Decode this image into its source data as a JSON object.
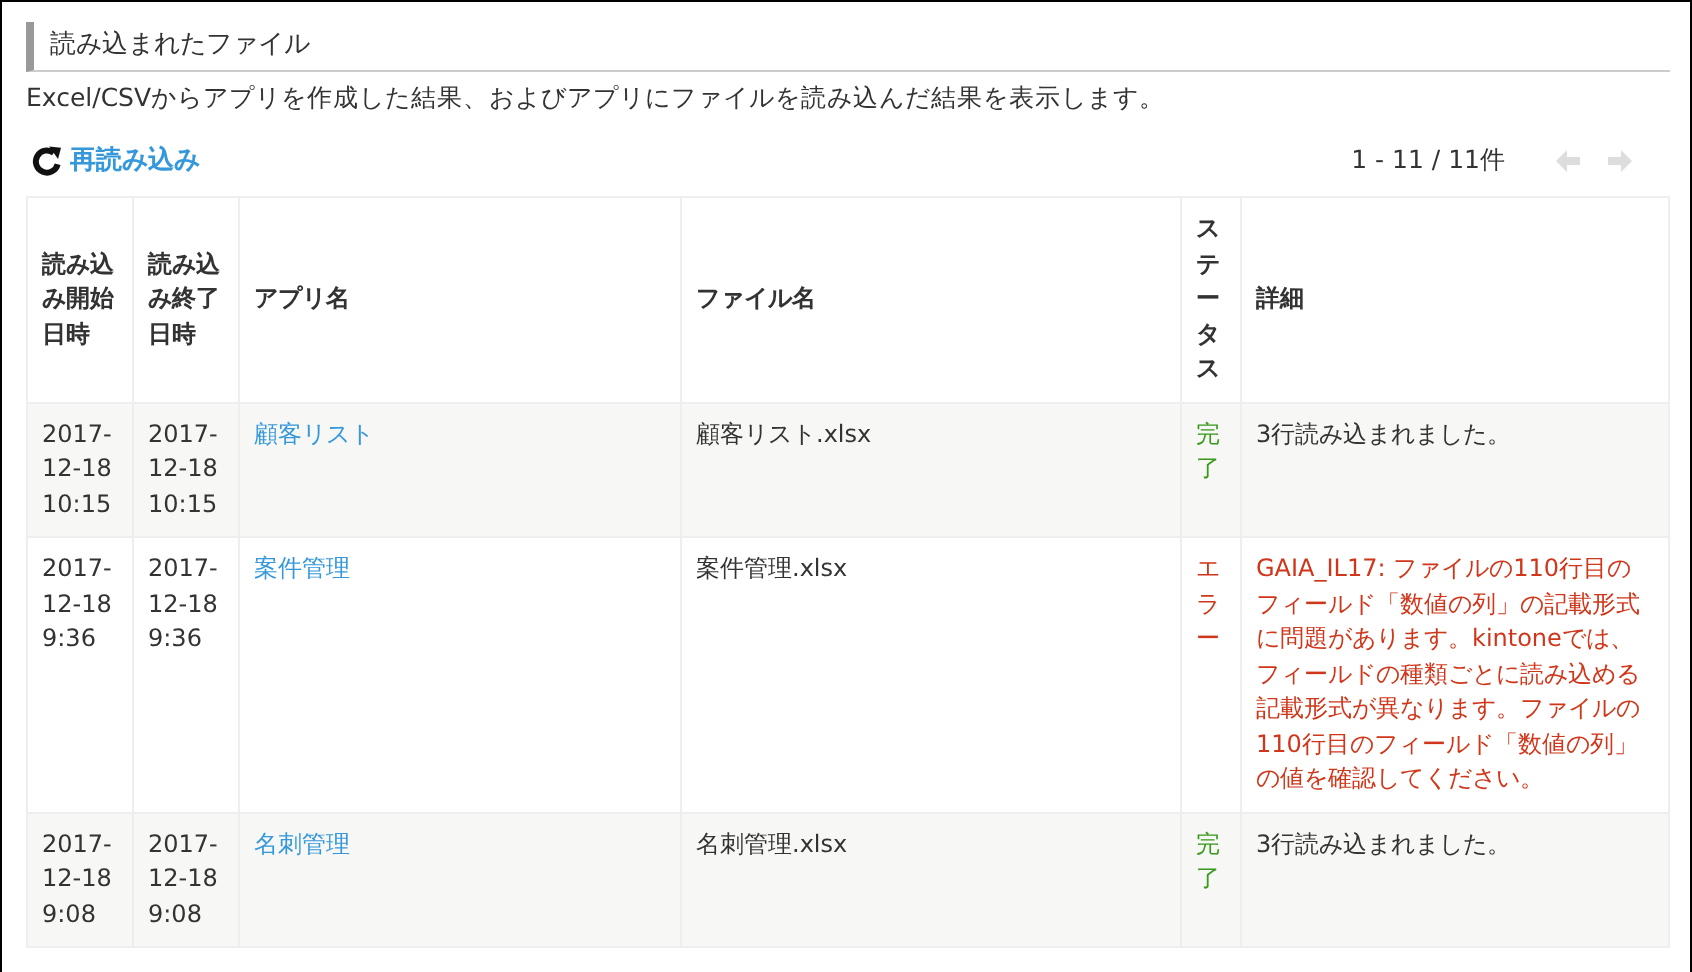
{
  "section_title": "読み込まれたファイル",
  "description": "Excel/CSVからアプリを作成した結果、およびアプリにファイルを読み込んだ結果を表示します。",
  "reload_link": "再読み込み",
  "pager": {
    "range": "1 - 11 / 11件",
    "prev_disabled": true,
    "next_disabled": true
  },
  "table": {
    "columns": [
      "読み込み開始日時",
      "読み込み終了日時",
      "アプリ名",
      "ファイル名",
      "ステータス",
      "詳細"
    ],
    "rows": [
      {
        "start": "2017-12-18 10:15",
        "end": "2017-12-18 10:15",
        "app": "顧客リスト",
        "file": "顧客リスト.xlsx",
        "status": "完了",
        "kind": "done",
        "detail": "3行読み込まれました。"
      },
      {
        "start": "2017-12-18 9:36",
        "end": "2017-12-18 9:36",
        "app": "案件管理",
        "file": "案件管理.xlsx",
        "status": "エラー",
        "kind": "error",
        "detail": "GAIA_IL17: ファイルの110行目のフィールド「数値の列」の記載形式に問題があります。kintoneでは、フィールドの種類ごとに読み込める記載形式が異なります。ファイルの110行目のフィールド「数値の列」の値を確認してください。"
      },
      {
        "start": "2017-12-18 9:08",
        "end": "2017-12-18 9:08",
        "app": "名刺管理",
        "file": "名刺管理.xlsx",
        "status": "完了",
        "kind": "done",
        "detail": "3行読み込まれました。"
      }
    ]
  }
}
